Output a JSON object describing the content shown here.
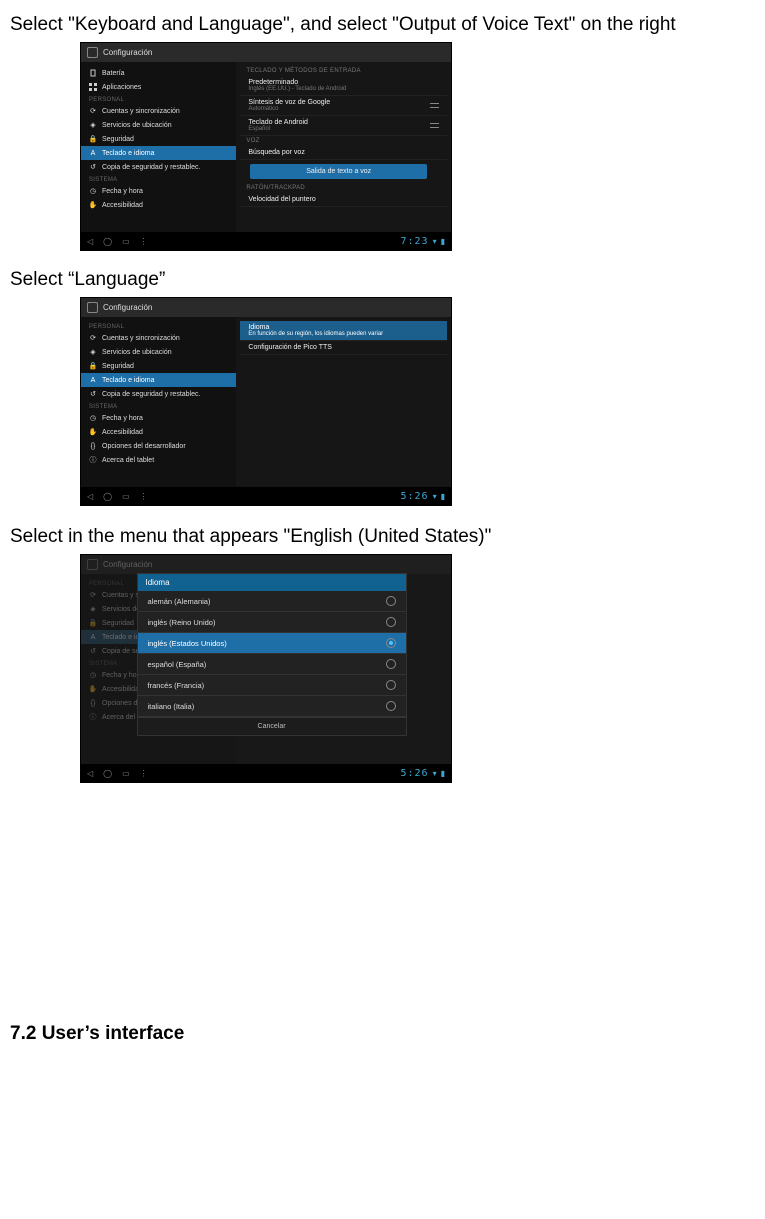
{
  "instructions": {
    "p1": "Select \"Keyboard and Language\", and select \"Output of Voice Text\" on the right",
    "p2": "Select “Language”",
    "p3": "Select in the menu that appears \"English (United States)\"",
    "heading": "7.2 User’s interface"
  },
  "shot1": {
    "title": "Configuración",
    "sidebar": {
      "items": [
        {
          "icon": "battery",
          "label": "Batería"
        },
        {
          "icon": "apps",
          "label": "Aplicaciones"
        }
      ],
      "cat_personal": "PERSONAL",
      "personal": [
        {
          "icon": "sync",
          "label": "Cuentas y sincronización"
        },
        {
          "icon": "location",
          "label": "Servicios de ubicación"
        },
        {
          "icon": "lock",
          "label": "Seguridad"
        },
        {
          "icon": "lang",
          "label": "Teclado e idioma",
          "selected": true
        },
        {
          "icon": "backup",
          "label": "Copia de seguridad y restablec."
        }
      ],
      "cat_system": "SISTEMA",
      "system": [
        {
          "icon": "clock",
          "label": "Fecha y hora"
        },
        {
          "icon": "hand",
          "label": "Accesibilidad"
        }
      ]
    },
    "main": {
      "hdr1": "TECLADO Y MÉTODOS DE ENTRADA",
      "items": [
        {
          "label": "Predeterminado",
          "sub": "Inglés (EE.UU.) - Teclado de Android"
        },
        {
          "label": "Síntesis de voz de Google",
          "sub": "Automático",
          "ctrl": "sliders"
        },
        {
          "label": "Teclado de Android",
          "sub": "Español",
          "ctrl": "sliders"
        }
      ],
      "hdr2": "VOZ",
      "voice": [
        {
          "label": "Búsqueda por voz"
        },
        {
          "label": "Salida de texto a voz",
          "selected": true
        }
      ],
      "hdr3": "RATÓN/TRACKPAD",
      "mouse": [
        {
          "label": "Velocidad del puntero"
        }
      ]
    },
    "nav": {
      "time": "7:23",
      "icons": [
        "back",
        "home",
        "recent",
        "menu"
      ]
    }
  },
  "shot2": {
    "title": "Configuración",
    "sidebar": {
      "cat_personal": "PERSONAL",
      "personal": [
        {
          "icon": "sync",
          "label": "Cuentas y sincronización"
        },
        {
          "icon": "location",
          "label": "Servicios de ubicación"
        },
        {
          "icon": "lock",
          "label": "Seguridad"
        },
        {
          "icon": "lang",
          "label": "Teclado e idioma",
          "selected": true
        },
        {
          "icon": "backup",
          "label": "Copia de seguridad y restablec."
        }
      ],
      "cat_system": "SISTEMA",
      "system": [
        {
          "icon": "clock",
          "label": "Fecha y hora"
        },
        {
          "icon": "hand",
          "label": "Accesibilidad"
        },
        {
          "icon": "dev",
          "label": "Opciones del desarrollador"
        },
        {
          "icon": "info",
          "label": "Acerca del tablet"
        }
      ]
    },
    "main": {
      "items": [
        {
          "label": "Idioma",
          "sub": "En función de su región, los idiomas pueden variar",
          "selected": true
        },
        {
          "label": "Configuración de Pico TTS"
        }
      ]
    },
    "nav": {
      "time": "5:26"
    }
  },
  "shot3": {
    "title": "Configuración",
    "sidebar": {
      "cat_personal": "PERSONAL",
      "personal": [
        {
          "icon": "sync",
          "label": "Cuentas y sincronización"
        },
        {
          "icon": "location",
          "label": "Servicios de ubicación"
        },
        {
          "icon": "lock",
          "label": "Seguridad"
        },
        {
          "icon": "lang",
          "label": "Teclado e idioma",
          "selected": true
        },
        {
          "icon": "backup",
          "label": "Copia de seguridad y restablec."
        }
      ],
      "cat_system": "SISTEMA",
      "system": [
        {
          "icon": "clock",
          "label": "Fecha y hora"
        },
        {
          "icon": "hand",
          "label": "Accesibilidad"
        },
        {
          "icon": "dev",
          "label": "Opciones del desarrollador"
        },
        {
          "icon": "info",
          "label": "Acerca del tablet"
        }
      ]
    },
    "dialog": {
      "title": "Idioma",
      "options": [
        {
          "label": "alemán (Alemania)"
        },
        {
          "label": "inglés (Reino Unido)"
        },
        {
          "label": "inglés (Estados Unidos)",
          "selected": true
        },
        {
          "label": "español (España)"
        },
        {
          "label": "francés (Francia)"
        },
        {
          "label": "italiano (Italia)"
        }
      ],
      "cancel": "Cancelar"
    },
    "nav": {
      "time": "5:26"
    }
  }
}
